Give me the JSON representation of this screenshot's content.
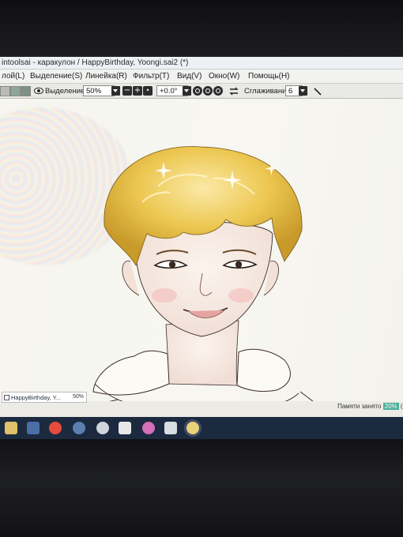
{
  "window": {
    "title": "intoolsai - каракулон / HappyBirthday, Yoongi.sai2 (*)"
  },
  "menu": [
    {
      "label": "лой(L)"
    },
    {
      "label": "Выделение(S)"
    },
    {
      "label": "Линейка(R)"
    },
    {
      "label": "Фильтр(T)"
    },
    {
      "label": "Вид(V)"
    },
    {
      "label": "Окно(W)"
    },
    {
      "label": "Помощь(H)"
    }
  ],
  "toolbar": {
    "selection_label": "Выделение",
    "zoom_value": "50%",
    "rotation_value": "+0.0°",
    "smoothing_label": "Сглаживание",
    "smoothing_value": "6"
  },
  "navigator": {
    "doc_name": "HappyBirthday, Y...",
    "zoom": "50%"
  },
  "status": {
    "memory_label": "Памяти занято",
    "memory_value": "20%",
    "memory_suffix": "(2"
  },
  "colors": {
    "menu_bg": "#f2f2f0",
    "taskbar_bg": "#1c2a40",
    "hair_blonde": "#e8c24a",
    "memory_badge": "#4cae9a"
  },
  "taskbar_icons": [
    "folder-icon",
    "store-icon",
    "yandex-icon",
    "app-icon",
    "chrome-icon",
    "bow-icon",
    "color-icon",
    "mail-icon",
    "sai-icon"
  ]
}
